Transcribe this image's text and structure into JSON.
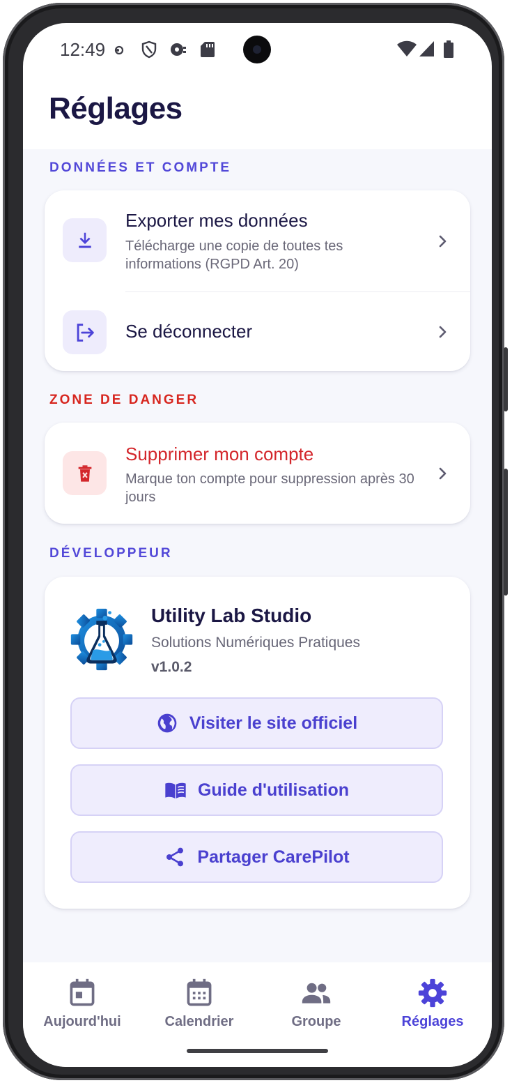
{
  "status_bar": {
    "time": "12:49",
    "left_icons": [
      "notification-dot-icon",
      "shield-icon",
      "media-icon",
      "sd-card-icon"
    ],
    "right_icons": [
      "wifi-icon",
      "signal-icon",
      "battery-icon"
    ]
  },
  "header": {
    "title": "Réglages"
  },
  "sections": {
    "account": {
      "label": "DONNÉES ET COMPTE",
      "export": {
        "title": "Exporter mes données",
        "subtitle": "Télécharge une copie de toutes tes informations (RGPD Art. 20)",
        "icon": "download-icon"
      },
      "logout": {
        "title": "Se déconnecter",
        "icon": "logout-icon"
      }
    },
    "danger": {
      "label": "ZONE DE DANGER",
      "delete": {
        "title": "Supprimer mon compte",
        "subtitle": "Marque ton compte pour suppression après 30 jours",
        "icon": "trash-icon"
      }
    },
    "developer": {
      "label": "DÉVELOPPEUR",
      "name": "Utility Lab Studio",
      "tagline": "Solutions Numériques Pratiques",
      "version": "v1.0.2",
      "buttons": {
        "website": "Visiter le site officiel",
        "guide": "Guide d'utilisation",
        "share": "Partager CarePilot"
      }
    }
  },
  "nav": {
    "items": [
      {
        "label": "Aujourd'hui",
        "icon": "calendar-today-icon"
      },
      {
        "label": "Calendrier",
        "icon": "calendar-month-icon"
      },
      {
        "label": "Groupe",
        "icon": "group-icon"
      },
      {
        "label": "Réglages",
        "icon": "gear-icon"
      }
    ],
    "active": "Réglages"
  },
  "colors": {
    "accent": "#4c43d8",
    "danger": "#d3262b",
    "title": "#1b1744",
    "background": "#f6f7fc"
  }
}
